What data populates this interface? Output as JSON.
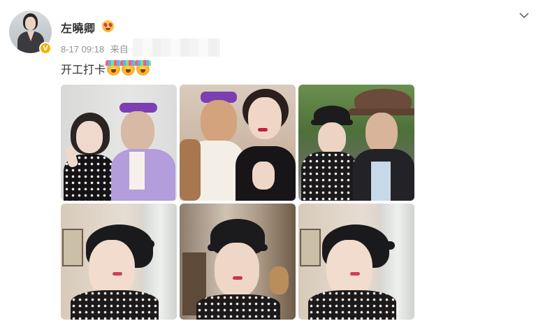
{
  "post": {
    "author": "左曉卿",
    "timestamp": "8-17 09:18",
    "source_prefix": "来自",
    "text": "开工打卡",
    "photos": [
      {
        "alt": "photo-1"
      },
      {
        "alt": "photo-2"
      },
      {
        "alt": "photo-3"
      },
      {
        "alt": "photo-4"
      },
      {
        "alt": "photo-5"
      },
      {
        "alt": "photo-6"
      }
    ]
  },
  "icons": {
    "verified_badge": "V",
    "author_emoji": "heart-eyes-emoji",
    "text_emojis": [
      "celebrate-emoji",
      "celebrate-emoji",
      "celebrate-emoji"
    ],
    "menu": "chevron-down-icon"
  },
  "colors": {
    "text": "#333333",
    "meta": "#939393",
    "verified": "#f4b400"
  }
}
